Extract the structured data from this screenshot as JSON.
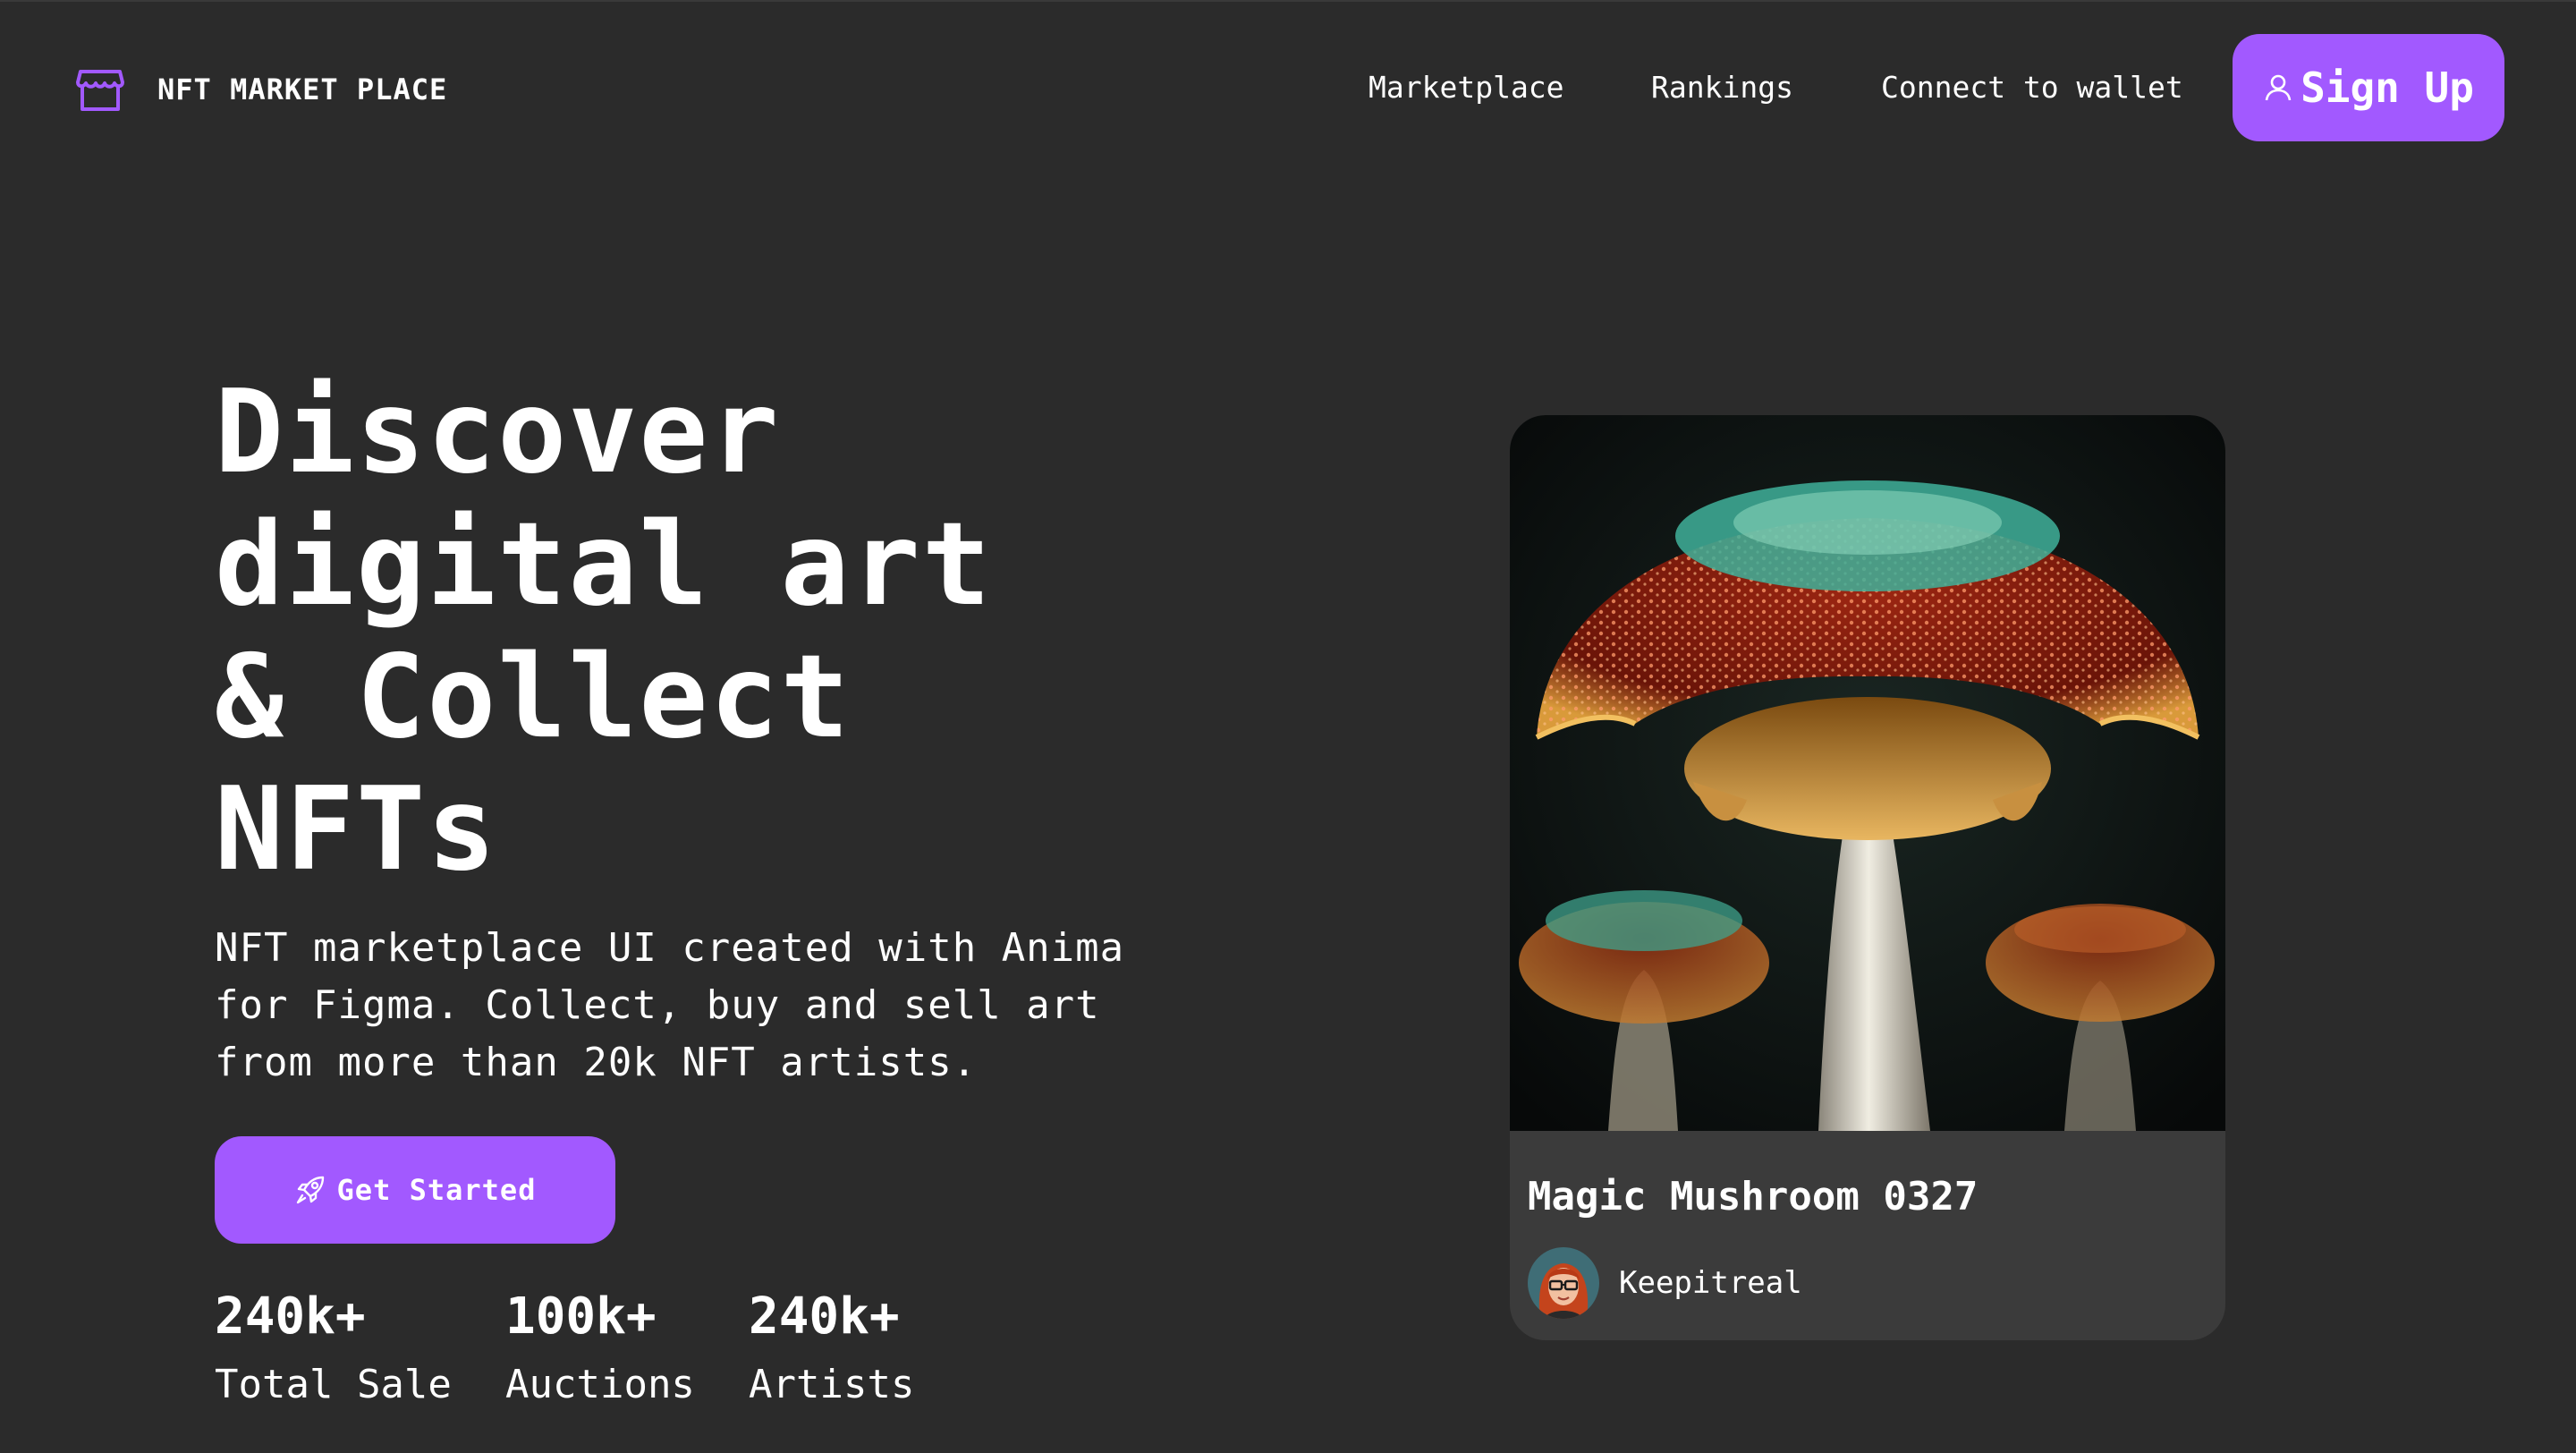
{
  "header": {
    "brand_name": "NFT MARKET PLACE",
    "nav": [
      "Marketplace",
      "Rankings",
      "Connect to wallet"
    ],
    "signup_label": "Sign Up"
  },
  "hero": {
    "title_lines": [
      "Discover",
      "digital art",
      "& Collect",
      "NFTs"
    ],
    "description_lines": [
      "NFT marketplace UI created with Anima",
      "for Figma. Collect, buy and sell art",
      "from more than 20k NFT artists."
    ],
    "cta_label": "Get Started",
    "stats": [
      {
        "value": "240k+",
        "label": "Total Sale"
      },
      {
        "value": "100k+",
        "label": "Auctions"
      },
      {
        "value": "240k+",
        "label": "Artists"
      }
    ]
  },
  "card": {
    "title": "Magic Mushroom 0327",
    "artist": "Keepitreal"
  },
  "colors": {
    "background": "#2b2b2b",
    "accent": "#a259ff",
    "card_background": "#3b3b3b",
    "text": "#ffffff"
  },
  "icons": {
    "brand": "storefront-icon",
    "signup": "user-icon",
    "cta": "rocket-icon"
  }
}
